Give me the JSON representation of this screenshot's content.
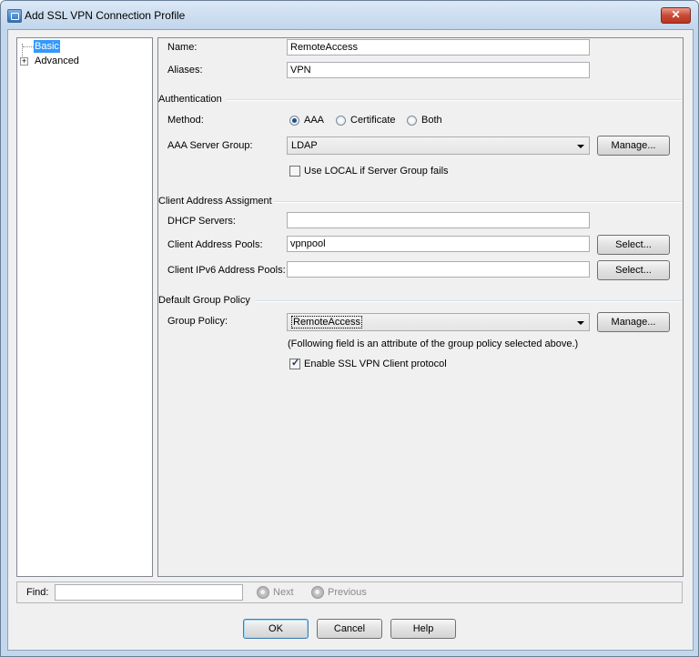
{
  "window": {
    "title": "Add SSL VPN Connection Profile",
    "close_label": "✕"
  },
  "tree": {
    "items": [
      {
        "label": "Basic",
        "selected": true
      },
      {
        "label": "Advanced",
        "expander": "+"
      }
    ]
  },
  "basic": {
    "name_label": "Name:",
    "name_value": "RemoteAccess",
    "aliases_label": "Aliases:",
    "aliases_value": "VPN"
  },
  "authentication": {
    "section_title": "Authentication",
    "method_label": "Method:",
    "methods": [
      {
        "label": "AAA",
        "selected": true
      },
      {
        "label": "Certificate",
        "selected": false
      },
      {
        "label": "Both",
        "selected": false
      }
    ],
    "server_group_label": "AAA Server Group:",
    "server_group_value": "LDAP",
    "manage_label": "Manage...",
    "use_local_label": "Use LOCAL if Server Group fails",
    "use_local_checked": false
  },
  "client_address": {
    "section_title": "Client Address Assigment",
    "dhcp_label": "DHCP Servers:",
    "dhcp_value": "",
    "pools_label": "Client Address Pools:",
    "pools_value": "vpnpool",
    "ipv6_label": "Client IPv6 Address Pools:",
    "ipv6_value": "",
    "select_label": "Select..."
  },
  "group_policy": {
    "section_title": "Default Group Policy",
    "label": "Group Policy:",
    "value": "RemoteAccess",
    "manage_label": "Manage...",
    "note": "(Following field is an attribute of the group policy selected above.)",
    "enable_ssl_label": "Enable SSL VPN Client protocol",
    "enable_ssl_checked": true
  },
  "find": {
    "label": "Find:",
    "value": "",
    "next_label": "Next",
    "previous_label": "Previous"
  },
  "footer": {
    "ok_label": "OK",
    "cancel_label": "Cancel",
    "help_label": "Help"
  },
  "icons": {
    "title": "window-app-icon",
    "check": "✓"
  }
}
